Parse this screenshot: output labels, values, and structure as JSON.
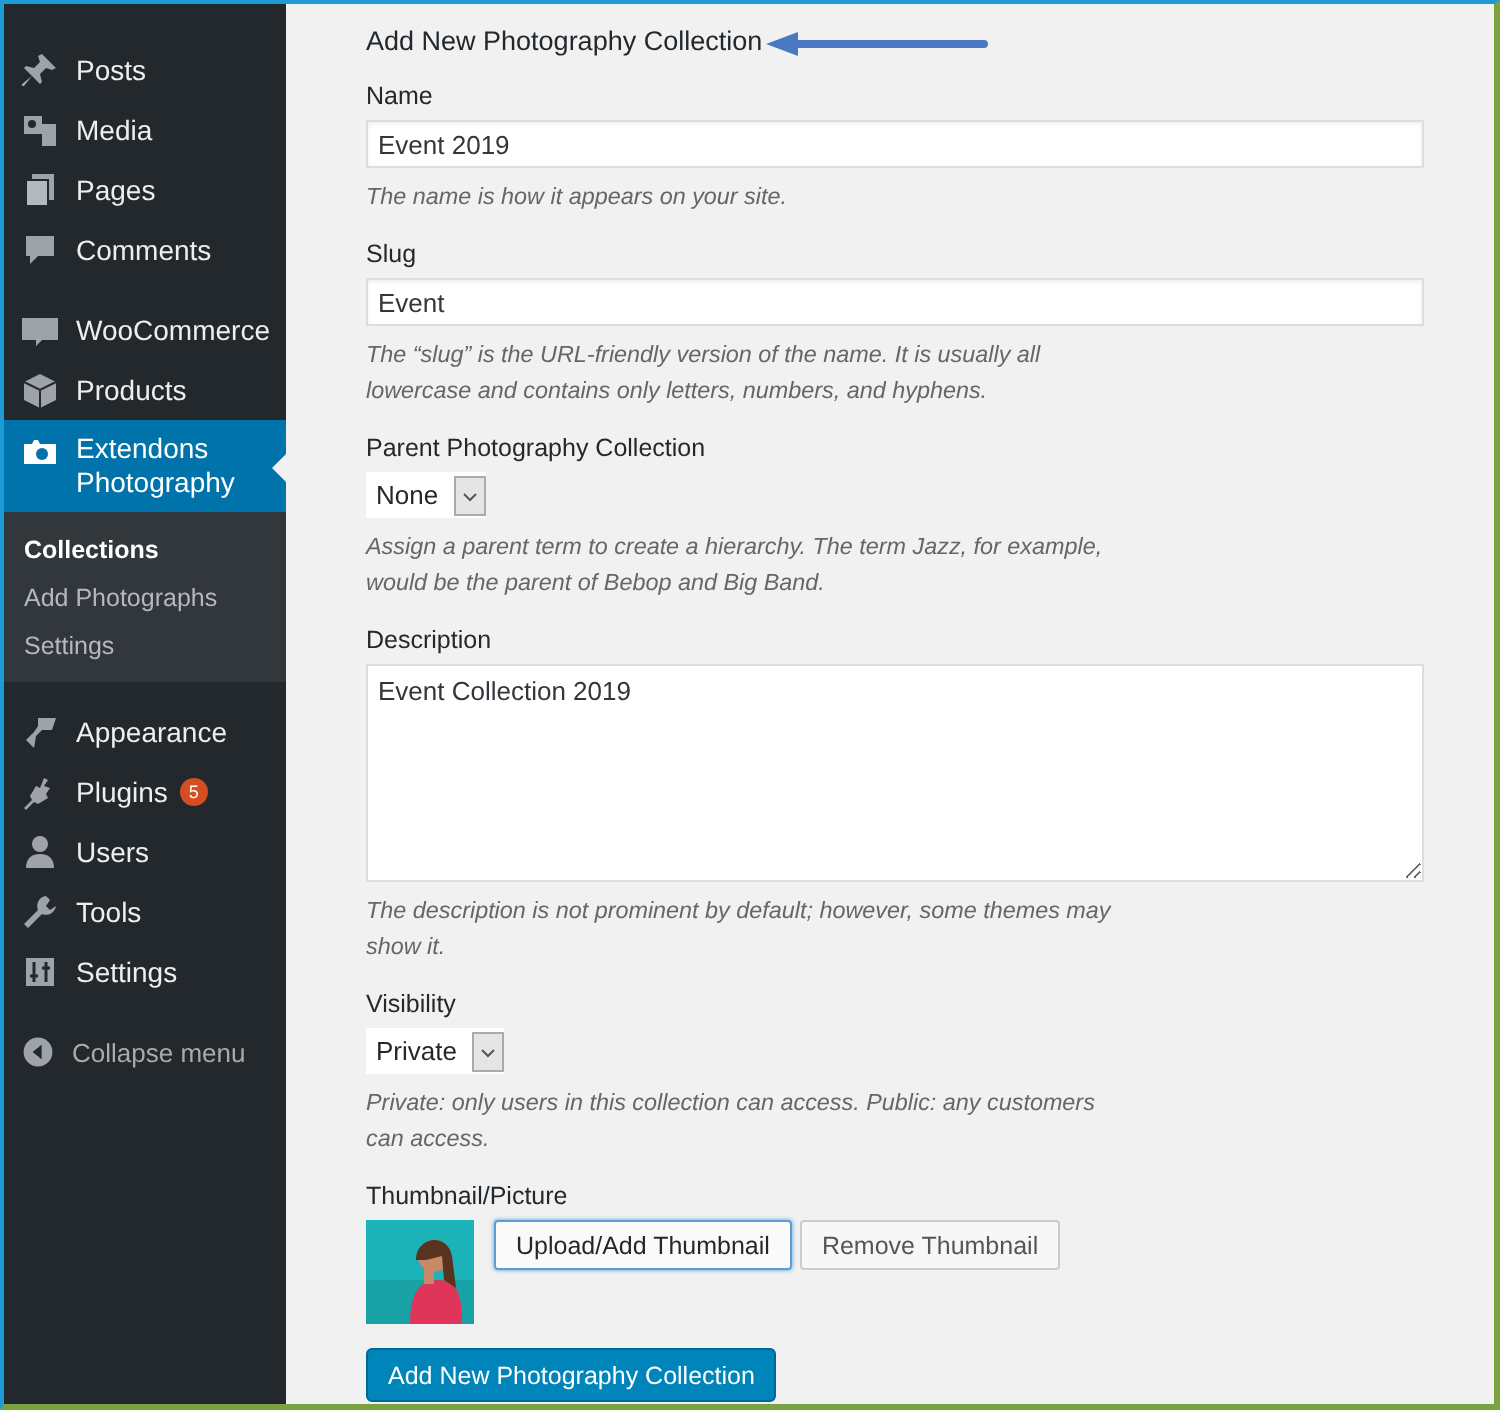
{
  "sidebar": {
    "groups": [
      {
        "items": [
          {
            "label": "Posts",
            "selected": false
          },
          {
            "label": "Media",
            "selected": false
          },
          {
            "label": "Pages",
            "selected": false
          },
          {
            "label": "Comments",
            "selected": false
          }
        ]
      },
      {
        "items": [
          {
            "label": "WooCommerce",
            "selected": false
          },
          {
            "label": "Products",
            "selected": false
          },
          {
            "label": "Extendons Photography",
            "selected": true,
            "submenu": [
              {
                "label": "Collections",
                "selected": true
              },
              {
                "label": "Add Photographs",
                "selected": false
              },
              {
                "label": "Settings",
                "selected": false
              }
            ]
          }
        ]
      },
      {
        "items": [
          {
            "label": "Appearance",
            "selected": false
          },
          {
            "label": "Plugins",
            "selected": false,
            "badge": "5"
          },
          {
            "label": "Users",
            "selected": false
          },
          {
            "label": "Tools",
            "selected": false
          },
          {
            "label": "Settings",
            "selected": false
          }
        ]
      }
    ],
    "collapse": "Collapse menu"
  },
  "form": {
    "title": "Add New Photography Collection",
    "fields": [
      {
        "kind": "text",
        "label": "Name",
        "value": "Event 2019",
        "description": "The name is how it appears on your site."
      },
      {
        "kind": "text",
        "label": "Slug",
        "value": "Event",
        "description": "The “slug” is the URL-friendly version of the name. It is usually all lowercase and contains only letters, numbers, and hyphens."
      },
      {
        "kind": "select",
        "label": "Parent Photography Collection",
        "value": "None",
        "description": "Assign a parent term to create a hierarchy. The term Jazz, for example, would be the parent of Bebop and Big Band."
      },
      {
        "kind": "textarea",
        "label": "Description",
        "value": "Event Collection 2019",
        "description": "The description is not prominent by default; however, some themes may show it."
      },
      {
        "kind": "select",
        "label": "Visibility",
        "value": "Private",
        "description": "Private: only users in this collection can access. Public: any customers can access."
      },
      {
        "kind": "thumbnail",
        "label": "Thumbnail/Picture",
        "image": {
          "kind": "picture"
        },
        "buttons": [
          {
            "label": "Upload/Add Thumbnail",
            "focused": true
          },
          {
            "label": "Remove Thumbnail",
            "focused": false
          }
        ]
      }
    ],
    "submit": "Add New Photography Collection"
  }
}
